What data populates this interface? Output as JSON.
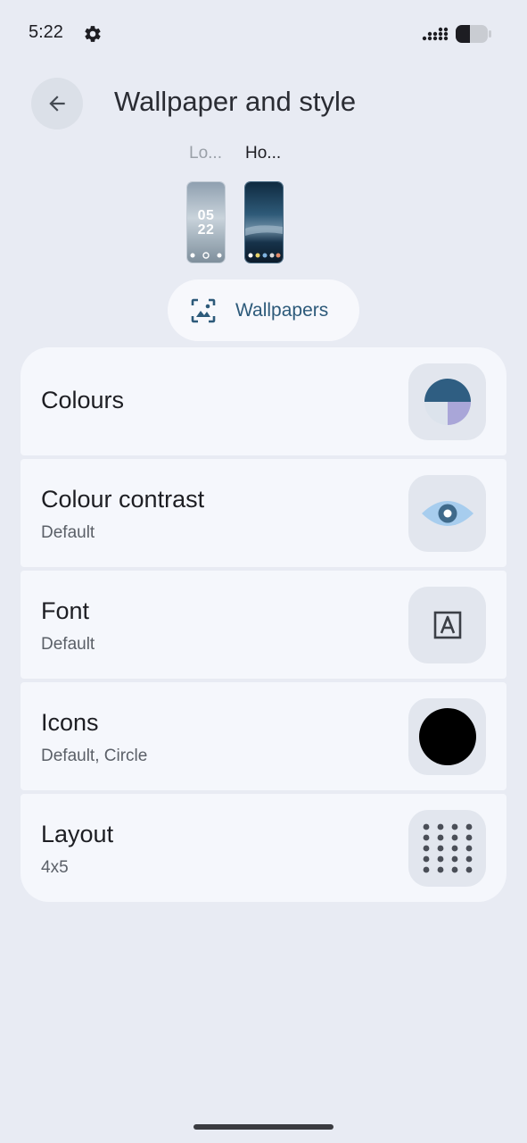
{
  "status_bar": {
    "time": "5:22",
    "icons": [
      "gear-icon",
      "signal-icon",
      "battery-icon"
    ]
  },
  "header": {
    "back_icon": "arrow-left-icon",
    "title": "Wallpaper and style"
  },
  "preview": {
    "tabs": [
      {
        "label": "Lo...",
        "selected": false
      },
      {
        "label": "Ho...",
        "selected": true
      }
    ],
    "lock_clock": [
      "05",
      "22"
    ]
  },
  "wallpapers_button": {
    "icon": "image-icon",
    "label": "Wallpapers"
  },
  "settings": [
    {
      "title": "Colours",
      "subtitle": "",
      "icon": "color-palette-icon"
    },
    {
      "title": "Colour contrast",
      "subtitle": "Default",
      "icon": "eye-icon"
    },
    {
      "title": "Font",
      "subtitle": "Default",
      "icon": "font-icon"
    },
    {
      "title": "Icons",
      "subtitle": "Default, Circle",
      "icon": "circle-shape-icon"
    },
    {
      "title": "Layout",
      "subtitle": "4x5",
      "icon": "grid-icon"
    }
  ],
  "colors": {
    "background": "#e8ebf3",
    "card": "#f5f7fc",
    "accent": "#2d5a7a",
    "palette_primary": "#2f5e82",
    "palette_secondary": "#a9a6d8",
    "palette_tertiary": "#dce3ec",
    "eye_outer": "#a7cdee",
    "eye_iris": "#3f6a8b"
  }
}
